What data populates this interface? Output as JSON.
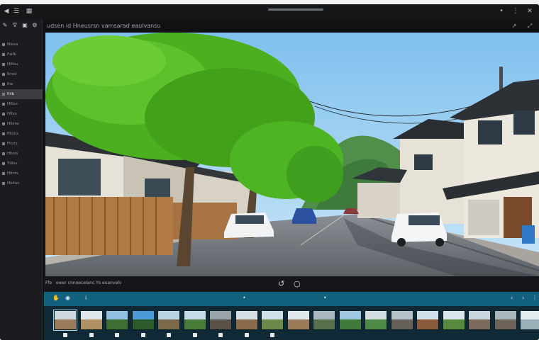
{
  "app": {
    "title": "udsen  id  Hneusrsn vamsarad eaulvansu"
  },
  "sidebar": {
    "items": [
      {
        "label": "Nlexa"
      },
      {
        "label": "Fwlb"
      },
      {
        "label": "Hlllou"
      },
      {
        "label": "Rrssl"
      },
      {
        "label": "Ihe"
      },
      {
        "label": "Ihlb"
      },
      {
        "label": "Hlllxs"
      },
      {
        "label": "Hflxs"
      },
      {
        "label": "Hllxns"
      },
      {
        "label": "Pllxns"
      },
      {
        "label": "Fllxrs"
      },
      {
        "label": "Hblxs"
      },
      {
        "label": "Tdlxs"
      },
      {
        "label": "Hllnrs"
      },
      {
        "label": "Hbllus"
      }
    ]
  },
  "controls": {
    "info_label": "Ffe",
    "info_detail": "ewer cnnoecelanc Ys euanvelv"
  },
  "filmstrip": {
    "thumbnails": [
      {
        "sky": "#cfd8dd",
        "land": "#9a7b5a"
      },
      {
        "sky": "#dfe7ea",
        "land": "#b08f62"
      },
      {
        "sky": "#8fc0e0",
        "land": "#3f6e34"
      },
      {
        "sky": "#4b9bd6",
        "land": "#2d5a2a"
      },
      {
        "sky": "#b9d3e4",
        "land": "#7a6a4a"
      },
      {
        "sky": "#c7dbe6",
        "land": "#4b7d3a"
      },
      {
        "sky": "#9aa4a8",
        "land": "#5a5248"
      },
      {
        "sky": "#d7dee3",
        "land": "#8a6b4c"
      },
      {
        "sky": "#cfe1ea",
        "land": "#6c8a4a"
      },
      {
        "sky": "#e1e8ec",
        "land": "#9c7c58"
      },
      {
        "sky": "#a9b8c0",
        "land": "#55704a"
      },
      {
        "sky": "#9fc7e2",
        "land": "#3f7a3a"
      },
      {
        "sky": "#d2dde2",
        "land": "#4d8a48"
      },
      {
        "sky": "#b7c2c8",
        "land": "#66605a"
      },
      {
        "sky": "#cfe0ea",
        "land": "#8a5a3a"
      },
      {
        "sky": "#dbe6ec",
        "land": "#5a8a3e"
      },
      {
        "sky": "#c8d5dc",
        "land": "#7b6a5c"
      },
      {
        "sky": "#a9b6bc",
        "land": "#6d6258"
      },
      {
        "sky": "#e4ebee",
        "land": "#9ab0b8"
      }
    ]
  },
  "colors": {
    "filmbar": "#11607d",
    "filmstrip": "#0f2a36",
    "sidebar": "#1b1c1f",
    "sky": "#a9d4f2",
    "foliage": "#4caf1f"
  }
}
